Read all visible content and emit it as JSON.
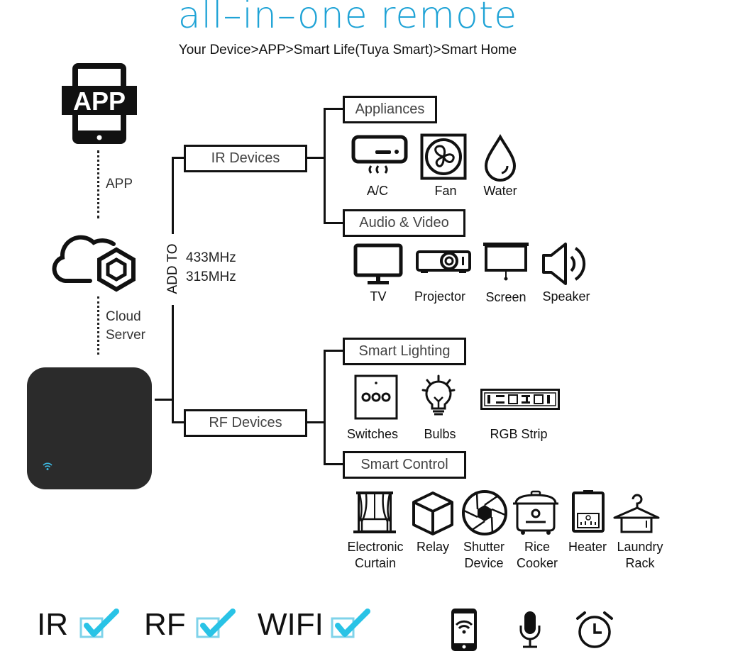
{
  "header": {
    "title": "all–in–one remote",
    "subtitle": "Your Device>APP>Smart Life(Tuya Smart)>Smart Home"
  },
  "left_column": {
    "app_icon_text": "APP",
    "app_label": "APP",
    "cloud_label_line1": "Cloud",
    "cloud_label_line2": "Server"
  },
  "trunk": {
    "add_to": "ADD TO",
    "freq1": "433MHz",
    "freq2": "315MHz"
  },
  "branches": {
    "ir": "IR Devices",
    "rf": "RF Devices"
  },
  "categories": {
    "appliances": {
      "label": "Appliances",
      "items": [
        "A/C",
        "Fan",
        "Water"
      ]
    },
    "audio_video": {
      "label": "Audio & Video",
      "items": [
        "TV",
        "Projector",
        "Screen",
        "Speaker"
      ]
    },
    "smart_lighting": {
      "label": "Smart Lighting",
      "items": [
        "Switches",
        "Bulbs",
        "RGB Strip"
      ]
    },
    "smart_control": {
      "label": "Smart Control",
      "items": [
        {
          "line1": "Electronic",
          "line2": "Curtain"
        },
        {
          "line1": "Relay",
          "line2": ""
        },
        {
          "line1": "Shutter",
          "line2": "Device"
        },
        {
          "line1": "Rice",
          "line2": "Cooker"
        },
        {
          "line1": "Heater",
          "line2": ""
        },
        {
          "line1": "Laundry",
          "line2": "Rack"
        }
      ]
    }
  },
  "features": {
    "ir": "IR",
    "rf": "RF",
    "wifi": "WIFI",
    "check_color": "#29c3e6",
    "icons": [
      "phone-wifi-icon",
      "microphone-icon",
      "alarm-clock-icon"
    ]
  },
  "colors": {
    "title": "#1fa3d6",
    "hub": "#2b2b2b",
    "wifi_led": "#3cb8e0"
  }
}
